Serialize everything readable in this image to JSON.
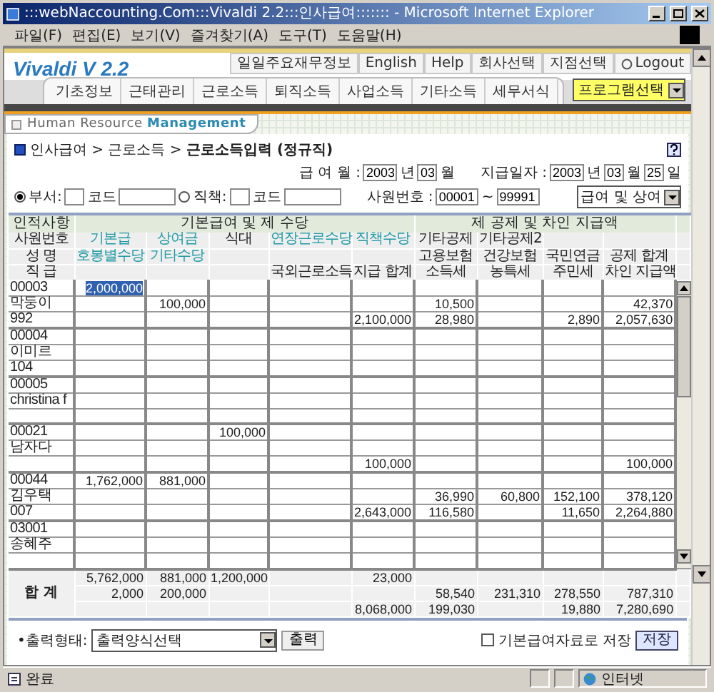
{
  "window": {
    "title": ":::webNaccounting.Com:::Vivaldi 2.2:::인사급여::::::: - Microsoft Internet Explorer"
  },
  "menu": [
    "파일(F)",
    "편집(E)",
    "보기(V)",
    "즐겨찾기(A)",
    "도구(T)",
    "도움말(H)"
  ],
  "top_links": [
    "일일주요재무정보",
    "English",
    "Help",
    "회사선택",
    "지점선택",
    "Logout"
  ],
  "logo": "Vivaldi V 2.2",
  "tabs": [
    {
      "label": "기초정보",
      "selected": false
    },
    {
      "label": "근태관리",
      "selected": false
    },
    {
      "label": "근로소득",
      "selected": false
    },
    {
      "label": "퇴직소득",
      "selected": false
    },
    {
      "label": "사업소득",
      "selected": false
    },
    {
      "label": "기타소득",
      "selected": false
    },
    {
      "label": "세무서식",
      "selected": false
    }
  ],
  "program_select": "프로그램선택",
  "module_tab": "Human Resource **Management**",
  "breadcrumb": "인사급여 > 근로소득 > **근로소득입력 (정규직)**",
  "pay_month": {
    "label": "급 여 월 :",
    "year": "2003",
    "year_unit": "년",
    "month": "03",
    "month_unit": "월"
  },
  "pay_date": {
    "label": "지급일자 :",
    "year": "2003",
    "year_unit": "년",
    "month": "03",
    "month_unit": "월",
    "day": "25",
    "day_unit": "일"
  },
  "filters": [
    {
      "label": "부서:",
      "selected": true,
      "code_label": "코드"
    },
    {
      "label": "직책:",
      "selected": false,
      "code_label": "코드"
    }
  ],
  "employee_range": {
    "label": "사원번호 :",
    "from": "00001",
    "separator": "~",
    "to": "99991"
  },
  "type_select": "급여 및 상여",
  "table": {
    "groups": [
      "인적사항",
      "기본급여 및 제 수당",
      "제 공제 및 차인 지급액"
    ],
    "header_rows": [
      [
        {
          "text": "사원번호",
          "kind": "fixed"
        },
        {
          "text": "기본급",
          "kind": "input"
        },
        {
          "text": "상여금",
          "kind": "input"
        },
        {
          "text": "식대",
          "kind": "fixed"
        },
        {
          "text": "연장근로수당",
          "kind": "input"
        },
        {
          "text": "직책수당",
          "kind": "input"
        },
        {
          "text": "기타공제",
          "kind": "fixed"
        },
        {
          "text": "기타공제2",
          "kind": "fixed"
        },
        null,
        null
      ],
      [
        {
          "text": "성  명",
          "kind": "fixed"
        },
        {
          "text": "호봉별수당",
          "kind": "input"
        },
        {
          "text": "기타수당",
          "kind": "input"
        },
        null,
        null,
        null,
        {
          "text": "고용보험",
          "kind": "fixed"
        },
        {
          "text": "건강보험",
          "kind": "fixed"
        },
        {
          "text": "국민연금",
          "kind": "fixed"
        },
        {
          "text": "공제 합계",
          "kind": "fixed"
        }
      ],
      [
        {
          "text": "직  급",
          "kind": "fixed"
        },
        null,
        null,
        null,
        {
          "text": "국외근로소득",
          "kind": "fixed"
        },
        {
          "text": "지급 합계",
          "kind": "fixed"
        },
        {
          "text": "소득세",
          "kind": "fixed"
        },
        {
          "text": "농특세",
          "kind": "fixed"
        },
        {
          "text": "주민세",
          "kind": "fixed"
        },
        {
          "text": "차인 지급액",
          "kind": "fixed"
        }
      ]
    ],
    "rows": [
      [
        "00003",
        {
          "value": "2,000,000",
          "selected": true
        }
      ],
      [
        "막둥이",
        null,
        "100,000",
        null,
        null,
        null,
        "10,500",
        null,
        null,
        "42,370"
      ],
      [
        "992",
        null,
        null,
        null,
        null,
        "2,100,000",
        "28,980",
        null,
        "2,890",
        "2,057,630"
      ],
      [
        "00004"
      ],
      [
        "이미르"
      ],
      [
        "104"
      ],
      [
        "00005"
      ],
      [
        "christina f"
      ],
      [
        null
      ],
      [
        "00021",
        null,
        null,
        "100,000"
      ],
      [
        "남자다"
      ],
      [
        null,
        null,
        null,
        null,
        null,
        "100,000",
        null,
        null,
        null,
        "100,000"
      ],
      [
        "00044",
        "1,762,000",
        "881,000"
      ],
      [
        "김우택",
        null,
        null,
        null,
        null,
        null,
        "36,990",
        "60,800",
        "152,100",
        "378,120"
      ],
      [
        "007",
        null,
        null,
        null,
        null,
        "2,643,000",
        "116,580",
        null,
        "11,650",
        "2,264,880"
      ],
      [
        "03001"
      ],
      [
        "송혜주"
      ],
      [
        null
      ]
    ],
    "totals_label": "합  계",
    "totals": [
      {
        "column_1": "5,762,000",
        "column_2": "881,000",
        "column_3": "1,200,000",
        "column_5": "23,000"
      },
      {
        "column_1": "2,000",
        "column_2": "200,000",
        "column_6": "58,540",
        "column_7": "231,310",
        "column_8": "278,550",
        "column_9": "787,310"
      },
      {
        "column_5": "8,068,000",
        "column_6": "199,030",
        "column_8": "19,880",
        "column_9": "7,280,690"
      }
    ]
  },
  "output": {
    "label": "•출력형태:",
    "select": "출력양식선택",
    "button": "출력"
  },
  "save": {
    "label": "기본급여자료로 저장",
    "checked": false,
    "button": "저장"
  },
  "status_bar": {
    "text": "완료",
    "zone": "인터넷"
  }
}
